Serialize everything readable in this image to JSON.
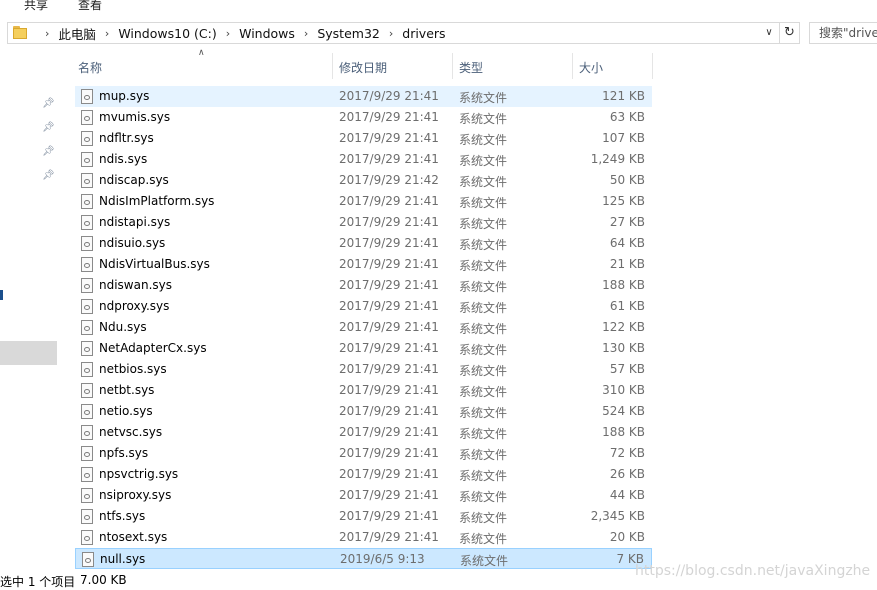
{
  "ribbon": {
    "tabs": [
      "共享",
      "查看"
    ]
  },
  "address": {
    "crumbs": [
      "此电脑",
      "Windows10 (C:)",
      "Windows",
      "System32",
      "drivers"
    ],
    "search_placeholder": "搜索\"drive"
  },
  "columns": {
    "name": "名称",
    "date": "修改日期",
    "type": "类型",
    "size": "大小"
  },
  "files": [
    {
      "name": "mup.sys",
      "date": "2017/9/29 21:41",
      "type": "系统文件",
      "size": "121 KB"
    },
    {
      "name": "mvumis.sys",
      "date": "2017/9/29 21:41",
      "type": "系统文件",
      "size": "63 KB"
    },
    {
      "name": "ndfltr.sys",
      "date": "2017/9/29 21:41",
      "type": "系统文件",
      "size": "107 KB"
    },
    {
      "name": "ndis.sys",
      "date": "2017/9/29 21:41",
      "type": "系统文件",
      "size": "1,249 KB"
    },
    {
      "name": "ndiscap.sys",
      "date": "2017/9/29 21:42",
      "type": "系统文件",
      "size": "50 KB"
    },
    {
      "name": "NdisImPlatform.sys",
      "date": "2017/9/29 21:41",
      "type": "系统文件",
      "size": "125 KB"
    },
    {
      "name": "ndistapi.sys",
      "date": "2017/9/29 21:41",
      "type": "系统文件",
      "size": "27 KB"
    },
    {
      "name": "ndisuio.sys",
      "date": "2017/9/29 21:41",
      "type": "系统文件",
      "size": "64 KB"
    },
    {
      "name": "NdisVirtualBus.sys",
      "date": "2017/9/29 21:41",
      "type": "系统文件",
      "size": "21 KB"
    },
    {
      "name": "ndiswan.sys",
      "date": "2017/9/29 21:41",
      "type": "系统文件",
      "size": "188 KB"
    },
    {
      "name": "ndproxy.sys",
      "date": "2017/9/29 21:41",
      "type": "系统文件",
      "size": "61 KB"
    },
    {
      "name": "Ndu.sys",
      "date": "2017/9/29 21:41",
      "type": "系统文件",
      "size": "122 KB"
    },
    {
      "name": "NetAdapterCx.sys",
      "date": "2017/9/29 21:41",
      "type": "系统文件",
      "size": "130 KB"
    },
    {
      "name": "netbios.sys",
      "date": "2017/9/29 21:41",
      "type": "系统文件",
      "size": "57 KB"
    },
    {
      "name": "netbt.sys",
      "date": "2017/9/29 21:41",
      "type": "系统文件",
      "size": "310 KB"
    },
    {
      "name": "netio.sys",
      "date": "2017/9/29 21:41",
      "type": "系统文件",
      "size": "524 KB"
    },
    {
      "name": "netvsc.sys",
      "date": "2017/9/29 21:41",
      "type": "系统文件",
      "size": "188 KB"
    },
    {
      "name": "npfs.sys",
      "date": "2017/9/29 21:41",
      "type": "系统文件",
      "size": "72 KB"
    },
    {
      "name": "npsvctrig.sys",
      "date": "2017/9/29 21:41",
      "type": "系统文件",
      "size": "26 KB"
    },
    {
      "name": "nsiproxy.sys",
      "date": "2017/9/29 21:41",
      "type": "系统文件",
      "size": "44 KB"
    },
    {
      "name": "ntfs.sys",
      "date": "2017/9/29 21:41",
      "type": "系统文件",
      "size": "2,345 KB"
    },
    {
      "name": "ntosext.sys",
      "date": "2017/9/29 21:41",
      "type": "系统文件",
      "size": "20 KB"
    },
    {
      "name": "null.sys",
      "date": "2019/6/5 9:13",
      "type": "系统文件",
      "size": "7 KB"
    }
  ],
  "status": {
    "selection": "选中 1 个项目",
    "size": "7.00 KB"
  },
  "watermark": "https://blog.csdn.net/javaXingzhe",
  "colors": {
    "hover_row": "#e5f3ff",
    "selected_row": "#cce8ff",
    "selected_border": "#99d1ff",
    "header_text": "#4c607a"
  }
}
